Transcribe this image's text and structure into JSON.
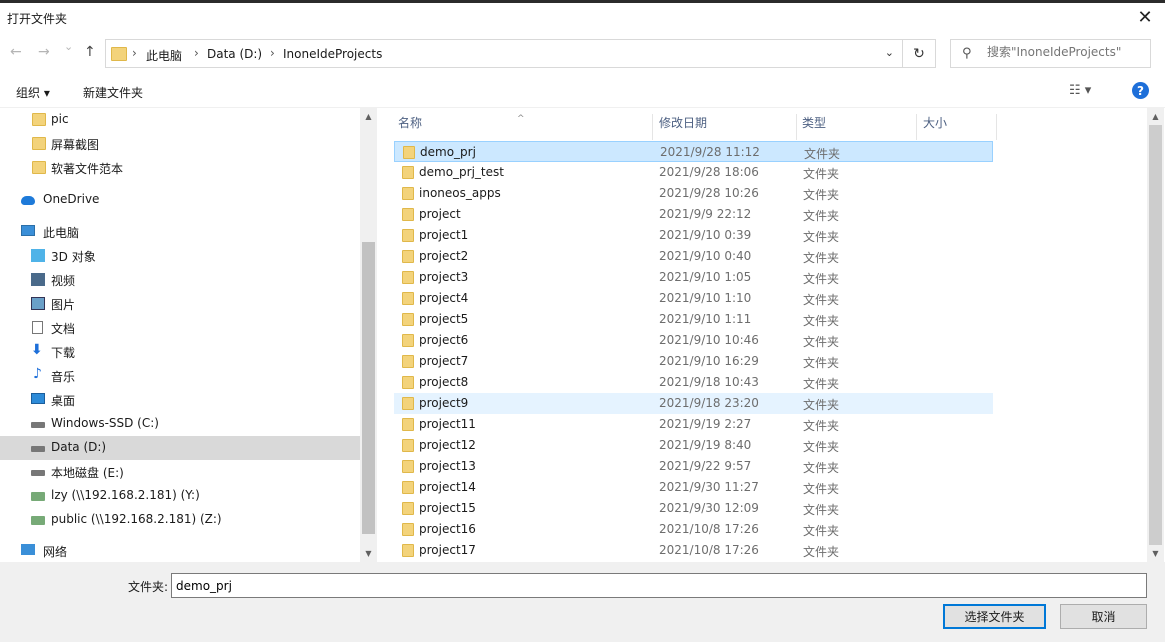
{
  "window": {
    "title": "打开文件夹",
    "close_glyph": "✕"
  },
  "nav": {
    "back_glyph": "←",
    "forward_glyph": "→",
    "recent_glyph": "⌄",
    "up_glyph": "↑"
  },
  "address": {
    "crumbs": [
      "此电脑",
      "Data (D:)",
      "InoneIdeProjects"
    ],
    "separator": "›",
    "dropdown_glyph": "⌄",
    "refresh_glyph": "↻"
  },
  "search": {
    "placeholder": "搜索\"InoneIdeProjects\"",
    "icon": "search-icon"
  },
  "toolbar": {
    "organize": "组织 ▾",
    "new_folder": "新建文件夹",
    "view_glyph": "☷ ▾",
    "help_glyph": "?"
  },
  "sidebar": {
    "items": [
      {
        "label": "pic",
        "icon": "folder-icon"
      },
      {
        "label": "屏幕截图",
        "icon": "folder-icon"
      },
      {
        "label": "软著文件范本",
        "icon": "folder-icon"
      },
      {
        "label": "OneDrive",
        "icon": "cloud-icon"
      },
      {
        "label": "此电脑",
        "icon": "computer-icon"
      },
      {
        "label": "3D 对象",
        "icon": "cube-icon"
      },
      {
        "label": "视频",
        "icon": "video-icon"
      },
      {
        "label": "图片",
        "icon": "pictures-icon"
      },
      {
        "label": "文档",
        "icon": "document-icon"
      },
      {
        "label": "下载",
        "icon": "download-icon",
        "glyph": "⬇"
      },
      {
        "label": "音乐",
        "icon": "music-icon",
        "glyph": "♪"
      },
      {
        "label": "桌面",
        "icon": "desktop-icon"
      },
      {
        "label": "Windows-SSD (C:)",
        "icon": "drive-icon"
      },
      {
        "label": "Data (D:)",
        "icon": "drive-icon",
        "selected": true
      },
      {
        "label": "本地磁盘 (E:)",
        "icon": "drive-icon"
      },
      {
        "label": "lzy (\\\\192.168.2.181) (Y:)",
        "icon": "network-drive-icon"
      },
      {
        "label": "public (\\\\192.168.2.181) (Z:)",
        "icon": "network-drive-icon"
      },
      {
        "label": "网络",
        "icon": "network-icon"
      }
    ]
  },
  "columns": {
    "name": "名称",
    "date": "修改日期",
    "type": "类型",
    "size": "大小",
    "sort_glyph": "^"
  },
  "files": [
    {
      "name": "demo_prj",
      "date": "2021/9/28 11:12",
      "type": "文件夹",
      "state": "selected"
    },
    {
      "name": "demo_prj_test",
      "date": "2021/9/28 18:06",
      "type": "文件夹"
    },
    {
      "name": "inoneos_apps",
      "date": "2021/9/28 10:26",
      "type": "文件夹"
    },
    {
      "name": "project",
      "date": "2021/9/9 22:12",
      "type": "文件夹"
    },
    {
      "name": "project1",
      "date": "2021/9/10 0:39",
      "type": "文件夹"
    },
    {
      "name": "project2",
      "date": "2021/9/10 0:40",
      "type": "文件夹"
    },
    {
      "name": "project3",
      "date": "2021/9/10 1:05",
      "type": "文件夹"
    },
    {
      "name": "project4",
      "date": "2021/9/10 1:10",
      "type": "文件夹"
    },
    {
      "name": "project5",
      "date": "2021/9/10 1:11",
      "type": "文件夹"
    },
    {
      "name": "project6",
      "date": "2021/9/10 10:46",
      "type": "文件夹"
    },
    {
      "name": "project7",
      "date": "2021/9/10 16:29",
      "type": "文件夹"
    },
    {
      "name": "project8",
      "date": "2021/9/18 10:43",
      "type": "文件夹"
    },
    {
      "name": "project9",
      "date": "2021/9/18 23:20",
      "type": "文件夹",
      "state": "hover"
    },
    {
      "name": "project11",
      "date": "2021/9/19 2:27",
      "type": "文件夹"
    },
    {
      "name": "project12",
      "date": "2021/9/19 8:40",
      "type": "文件夹"
    },
    {
      "name": "project13",
      "date": "2021/9/22 9:57",
      "type": "文件夹"
    },
    {
      "name": "project14",
      "date": "2021/9/30 11:27",
      "type": "文件夹"
    },
    {
      "name": "project15",
      "date": "2021/9/30 12:09",
      "type": "文件夹"
    },
    {
      "name": "project16",
      "date": "2021/10/8 17:26",
      "type": "文件夹"
    },
    {
      "name": "project17",
      "date": "2021/10/8 17:26",
      "type": "文件夹"
    }
  ],
  "footer": {
    "folder_label": "文件夹:",
    "folder_value": "demo_prj",
    "select_button": "选择文件夹",
    "cancel_button": "取消"
  },
  "scroll_glyphs": {
    "up": "▲",
    "down": "▼"
  }
}
